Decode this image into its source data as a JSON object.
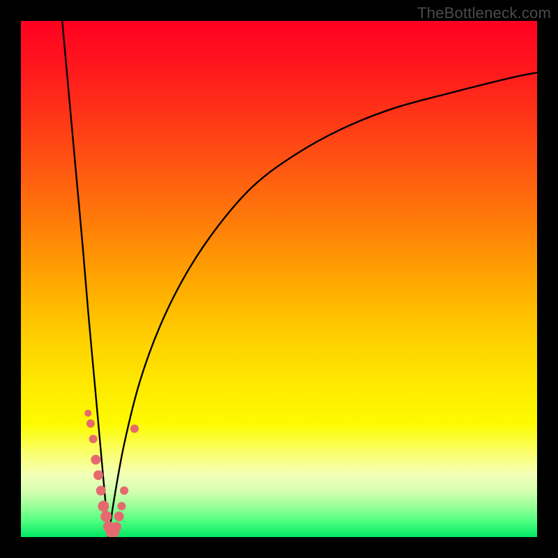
{
  "watermark": "TheBottleneck.com",
  "gradient": {
    "stops": [
      {
        "offset": 0.0,
        "color": "#ff0021"
      },
      {
        "offset": 0.1,
        "color": "#ff1a1c"
      },
      {
        "offset": 0.2,
        "color": "#ff3b16"
      },
      {
        "offset": 0.3,
        "color": "#ff5d11"
      },
      {
        "offset": 0.4,
        "color": "#ff8008"
      },
      {
        "offset": 0.5,
        "color": "#ffa601"
      },
      {
        "offset": 0.6,
        "color": "#ffcb00"
      },
      {
        "offset": 0.7,
        "color": "#fee800"
      },
      {
        "offset": 0.78,
        "color": "#fdfb00"
      },
      {
        "offset": 0.84,
        "color": "#fbff73"
      },
      {
        "offset": 0.88,
        "color": "#f3ffb8"
      },
      {
        "offset": 0.91,
        "color": "#d6ffb0"
      },
      {
        "offset": 0.94,
        "color": "#9bff98"
      },
      {
        "offset": 0.97,
        "color": "#4eff80"
      },
      {
        "offset": 1.0,
        "color": "#00e765"
      }
    ]
  },
  "chart_data": {
    "type": "line",
    "title": "",
    "xlabel": "",
    "ylabel": "",
    "xlim": [
      0,
      100
    ],
    "ylim": [
      0,
      100
    ],
    "note": "V-shaped bottleneck curve. y is percentage mismatch (0 = balanced at bottom/green, 100 = top/red). Minimum of curve lies around x≈17.",
    "series": [
      {
        "name": "bottleneck-curve-left",
        "x": [
          8,
          9,
          10,
          11,
          12,
          13,
          14,
          15,
          16,
          17
        ],
        "y": [
          100,
          89,
          78,
          67,
          56,
          44,
          33,
          22,
          11,
          0
        ]
      },
      {
        "name": "bottleneck-curve-right",
        "x": [
          17,
          18,
          20,
          23,
          27,
          32,
          38,
          45,
          53,
          62,
          72,
          83,
          95,
          100
        ],
        "y": [
          0,
          7,
          18,
          30,
          41,
          51,
          60,
          68,
          74,
          79,
          83,
          86,
          89,
          90
        ]
      }
    ],
    "markers": {
      "name": "sample-points",
      "color": "#e46a6f",
      "points": [
        {
          "x": 13.0,
          "y": 24,
          "r": 5
        },
        {
          "x": 13.5,
          "y": 22,
          "r": 6
        },
        {
          "x": 14.0,
          "y": 19,
          "r": 6
        },
        {
          "x": 14.5,
          "y": 15,
          "r": 7
        },
        {
          "x": 15.0,
          "y": 12,
          "r": 7
        },
        {
          "x": 15.5,
          "y": 9,
          "r": 7
        },
        {
          "x": 16.0,
          "y": 6,
          "r": 8
        },
        {
          "x": 16.5,
          "y": 4,
          "r": 8
        },
        {
          "x": 17.0,
          "y": 2,
          "r": 8
        },
        {
          "x": 17.5,
          "y": 1,
          "r": 8
        },
        {
          "x": 18.0,
          "y": 1,
          "r": 8
        },
        {
          "x": 18.5,
          "y": 2,
          "r": 7
        },
        {
          "x": 19.0,
          "y": 4,
          "r": 7
        },
        {
          "x": 19.5,
          "y": 6,
          "r": 6
        },
        {
          "x": 20.0,
          "y": 9,
          "r": 6
        },
        {
          "x": 22.0,
          "y": 21,
          "r": 6
        }
      ]
    }
  }
}
